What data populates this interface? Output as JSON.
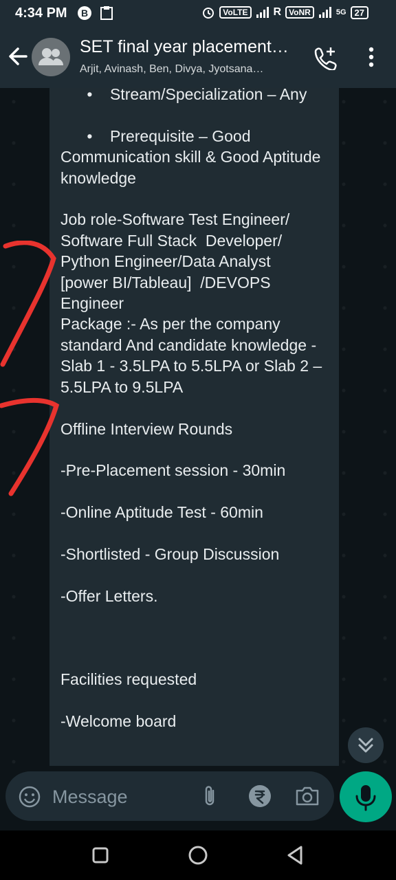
{
  "status_bar": {
    "time": "4:34 PM",
    "net_indicator": "R",
    "volte_label": "VoLTE",
    "vonr_label": "VoNR",
    "network_5g": "5G",
    "battery": "27"
  },
  "header": {
    "title": "SET final year placement…",
    "subtitle": "Arjit, Avinash, Ben, Divya, Jyotsana…"
  },
  "message": {
    "text": "      •    Stream/Specialization – Any\n\n      •    Prerequisite – Good Communication skill & Good Aptitude knowledge\n\nJob role-Software Test Engineer/\nSoftware Full Stack  Developer/\nPython Engineer/Data Analyst\n[power BI/Tableau]  /DEVOPS Engineer\nPackage :- As per the company standard And candidate knowledge - Slab 1 - 3.5LPA to 5.5LPA or Slab 2 – 5.5LPA to 9.5LPA\n\nOffline Interview Rounds\n\n-Pre-Placement session - 30min\n\n-Online Aptitude Test - 60min\n\n-Shortlisted - Group Discussion\n\n-Offer Letters.\n\n\n\nFacilities requested\n\n-Welcome board"
  },
  "composer": {
    "placeholder": "Message"
  },
  "icons": {
    "back": "arrow-left-icon",
    "avatar": "group-icon",
    "call_add": "call-add-icon",
    "menu": "more-vert-icon",
    "scroll_down": "double-chevron-down-icon",
    "emoji": "emoji-icon",
    "attach": "paperclip-icon",
    "payment": "rupee-icon",
    "camera": "camera-icon",
    "mic": "mic-icon"
  },
  "colors": {
    "header_bg": "#1f2c34",
    "bubble_bg": "#202c33",
    "mic_bg": "#00a884",
    "annotation": "#e8332e"
  }
}
